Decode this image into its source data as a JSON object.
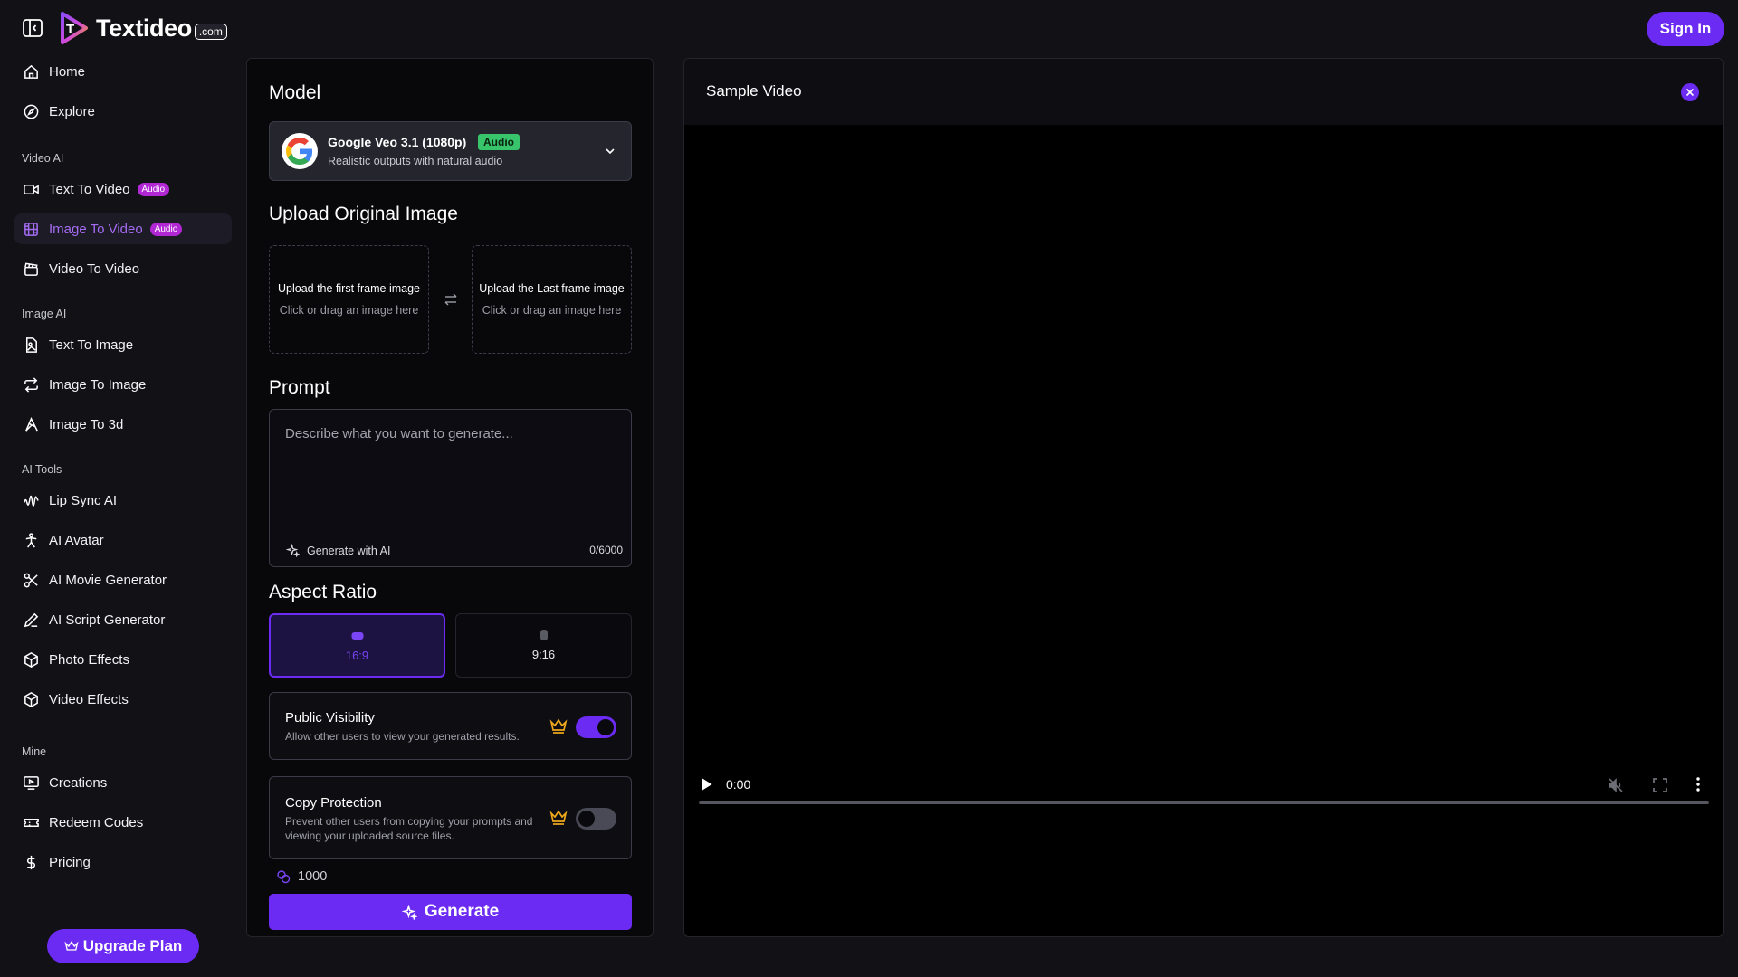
{
  "header": {
    "brand": "Textideo",
    "brand_tld": ".com",
    "sign_in_label": "Sign In"
  },
  "sidebar": {
    "top_items": [
      {
        "label": "Home",
        "icon": "home-icon"
      },
      {
        "label": "Explore",
        "icon": "compass-icon"
      }
    ],
    "sections": [
      {
        "title": "Video AI",
        "items": [
          {
            "label": "Text To Video",
            "badge": "Audio",
            "icon": "video-camera-icon"
          },
          {
            "label": "Image To Video",
            "badge": "Audio",
            "icon": "film-icon",
            "active": true
          },
          {
            "label": "Video To Video",
            "icon": "clapperboard-icon"
          }
        ]
      },
      {
        "title": "Image AI",
        "items": [
          {
            "label": "Text To Image",
            "icon": "image-file-icon"
          },
          {
            "label": "Image To Image",
            "icon": "repeat-icon"
          },
          {
            "label": "Image To 3d",
            "icon": "cube-3d-icon"
          }
        ]
      },
      {
        "title": "AI Tools",
        "items": [
          {
            "label": "Lip Sync AI",
            "icon": "audio-wave-icon"
          },
          {
            "label": "AI Avatar",
            "icon": "person-icon"
          },
          {
            "label": "AI Movie Generator",
            "icon": "scissors-icon"
          },
          {
            "label": "AI Script Generator",
            "icon": "pen-icon"
          },
          {
            "label": "Photo Effects",
            "icon": "box-icon"
          },
          {
            "label": "Video Effects",
            "icon": "box-icon"
          }
        ]
      },
      {
        "title": "Mine",
        "items": [
          {
            "label": "Creations",
            "icon": "monitor-play-icon"
          },
          {
            "label": "Redeem Codes",
            "icon": "ticket-icon"
          },
          {
            "label": "Pricing",
            "icon": "dollar-icon"
          }
        ]
      }
    ],
    "upgrade_label": "Upgrade Plan"
  },
  "form": {
    "model_title": "Model",
    "model": {
      "name": "Google Veo 3.1 (1080p)",
      "badge": "Audio",
      "description": "Realistic outputs with natural audio"
    },
    "upload_title": "Upload Original Image",
    "upload_first": {
      "title": "Upload the first frame image",
      "hint": "Click or drag an image here"
    },
    "upload_last": {
      "title": "Upload the Last frame image",
      "hint": "Click or drag an image here"
    },
    "prompt_title": "Prompt",
    "prompt": {
      "value": "",
      "placeholder": "Describe what you want to generate...",
      "generate_ai_label": "Generate with AI",
      "char_count": "0/6000"
    },
    "aspect_title": "Aspect Ratio",
    "aspect_ratios": [
      {
        "label": "16:9",
        "selected": true
      },
      {
        "label": "9:16",
        "selected": false
      }
    ],
    "public_visibility": {
      "title": "Public Visibility",
      "description": "Allow other users to view your generated results.",
      "enabled": true
    },
    "copy_protection": {
      "title": "Copy Protection",
      "description": "Prevent other users from copying your prompts and viewing your uploaded source files.",
      "enabled": false
    },
    "credits": "1000",
    "generate_label": "Generate"
  },
  "video": {
    "title": "Sample Video",
    "time": "0:00",
    "progress": 0
  },
  "colors": {
    "accent": "#6c2bf2",
    "audio_badge": "#b227d4",
    "model_badge": "#37c46a",
    "crown": "#f0a81c",
    "background": "#111116"
  }
}
